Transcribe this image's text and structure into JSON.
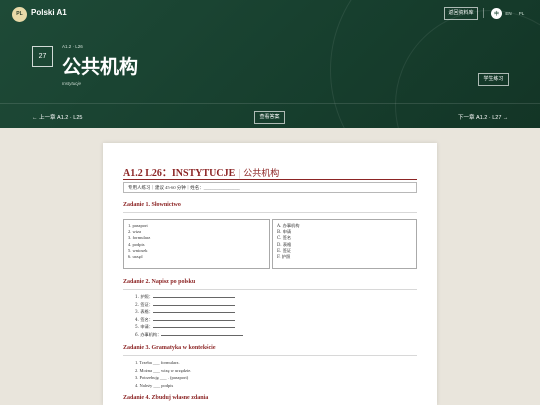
{
  "header": {
    "logo_text": "PL",
    "brand": "Polski A1",
    "back_button": "返回资料库",
    "languages": [
      "中",
      "EN",
      "PL"
    ],
    "lesson_number": "27",
    "breadcrumb": "A1.2 · L26",
    "title": "公共机构",
    "subtitle": "Instytucje",
    "student_button": "学生练习"
  },
  "nav": {
    "prev": "← 上一章 A1.2 · L25",
    "answers_button": "查看答案",
    "next": "下一章 A1.2 · L27 →"
  },
  "worksheet": {
    "title_code": "A1.2 L26：INSTYTUCJE",
    "title_separator": "|",
    "title_cn": "公共机构",
    "info": "专用人练习｜建议 45-60 分钟｜姓名：________________",
    "section1": {
      "title": "Zadanie 1. Słownictwo",
      "left": [
        "1. paszport",
        "2. wiza",
        "3. formularz",
        "4. podpis",
        "5. wniosek",
        "6. urząd"
      ],
      "right": [
        "A. 办事机构",
        "B. 申请",
        "C. 签名",
        "D. 表格",
        "E. 签证",
        "F. 护照"
      ]
    },
    "section2": {
      "title": "Zadanie 2. Napisz po polsku",
      "items": [
        "1. 护照：",
        "2. 签证：",
        "3. 表格：",
        "4. 签名：",
        "5. 申请：",
        "6. 办事机构："
      ]
    },
    "section3": {
      "title": "Zadanie 3. Gramatyka w kontekście",
      "items": [
        "1. Trzeba ___ formularz.",
        "2. Można ___ wizę w urzędzie.",
        "3. Potrzebuję ___ . (paszport)",
        "4. Należy ___ podpis"
      ]
    },
    "section4": {
      "title": "Zadanie 4. Zbuduj własne zdania"
    }
  }
}
